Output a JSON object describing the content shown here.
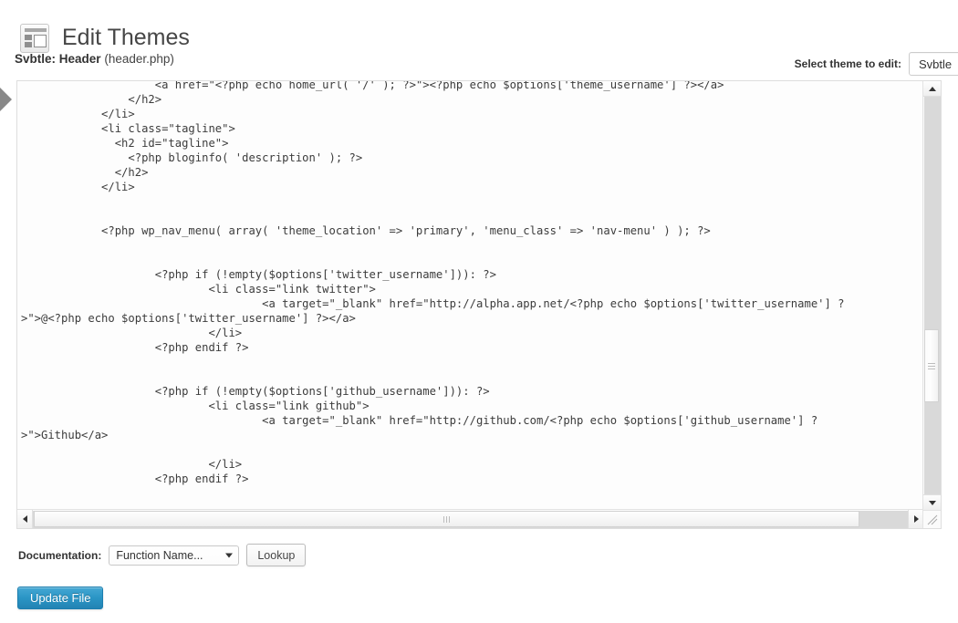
{
  "header": {
    "title": "Edit Themes",
    "icon": "appearance-layout-icon"
  },
  "sidebar": {
    "flyout_arrow_icon": "chevron-right-icon"
  },
  "file_info": {
    "theme_name": "Svbtle:",
    "file_label": "Header",
    "file_name": "(header.php)"
  },
  "theme_selector": {
    "label": "Select theme to edit:",
    "selected": "Svbtle",
    "options": [
      "Svbtle"
    ]
  },
  "editor": {
    "code": "                    <a href=\"<?php echo home_url( '/' ); ?>\"><?php echo $options['theme_username'] ?></a>\n                </h2>\n            </li>\n            <li class=\"tagline\">\n              <h2 id=\"tagline\">\n                <?php bloginfo( 'description' ); ?>\n              </h2>\n            </li>\n\n\n            <?php wp_nav_menu( array( 'theme_location' => 'primary', 'menu_class' => 'nav-menu' ) ); ?>\n\n\n                    <?php if (!empty($options['twitter_username'])): ?>\n                            <li class=\"link twitter\">\n                                    <a target=\"_blank\" href=\"http://alpha.app.net/<?php echo $options['twitter_username'] ?\n>\">@<?php echo $options['twitter_username'] ?></a>\n                            </li>\n                    <?php endif ?>\n\n\n                    <?php if (!empty($options['github_username'])): ?>\n                            <li class=\"link github\">\n                                    <a target=\"_blank\" href=\"http://github.com/<?php echo $options['github_username'] ?\n>\">Github</a>\n\n                            </li>\n                    <?php endif ?>\n\n\n                    <?php if (!empty($options['contact_email'])): ?>\n                            <li class=\"link email\">\n                                    <a href=\"mailto:<?php echo $options['contact_email'] ?>\">\n                                            email</a>",
    "vscroll": {
      "up_icon": "arrow-up-icon",
      "down_icon": "arrow-down-icon",
      "thumb_handle": "scrollbar-thumb"
    },
    "hscroll": {
      "left_icon": "arrow-left-icon",
      "right_icon": "arrow-right-icon",
      "thumb_handle": "scrollbar-thumb"
    },
    "resize_handle_icon": "resize-grip-icon"
  },
  "documentation": {
    "label": "Documentation:",
    "select_value": "Function Name...",
    "select_caret_icon": "chevron-down-icon",
    "lookup_button": "Lookup"
  },
  "actions": {
    "update_file": "Update File"
  },
  "colors": {
    "primary_button": "#2a95c5",
    "title_text": "#464646",
    "code_text": "#3c3c3c",
    "page_background": "#ffffff"
  }
}
